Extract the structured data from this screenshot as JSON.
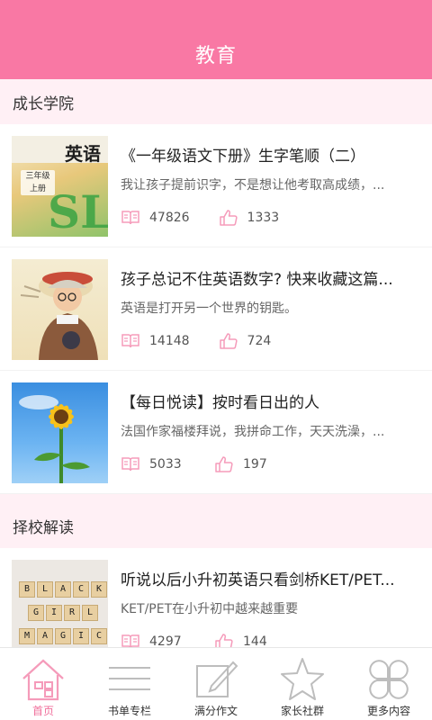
{
  "header": {
    "title": "教育"
  },
  "sections": [
    {
      "title": "成长学院",
      "items": [
        {
          "title": "《一年级语文下册》生字笔顺（二）",
          "subtitle": "我让孩子提前识字，不是想让他考取高成绩，...",
          "reads": "47826",
          "likes": "1333",
          "thumb_text": {
            "zh": "英语",
            "grade": "三年级 上册",
            "letters": "SL"
          }
        },
        {
          "title": "孩子总记不住英语数字? 快来收藏这篇...",
          "subtitle": "英语是打开另一个世界的钥匙。",
          "reads": "14148",
          "likes": "724"
        },
        {
          "title": "【每日悦读】按时看日出的人",
          "subtitle": "法国作家福楼拜说，我拼命工作，天天洗澡，...",
          "reads": "5033",
          "likes": "197"
        }
      ]
    },
    {
      "title": "择校解读",
      "items": [
        {
          "title": "听说以后小升初英语只看剑桥KET/PET...",
          "subtitle": "KET/PET在小升初中越来越重要",
          "reads": "4297",
          "likes": "144",
          "thumb_text": {
            "row1": [
              "B",
              "L",
              "A",
              "C",
              "K"
            ],
            "row2": [
              "G",
              "I",
              "R",
              "L"
            ],
            "row3": [
              "M",
              "A",
              "G",
              "I",
              "C"
            ]
          }
        }
      ]
    }
  ],
  "tabs": [
    {
      "label": "首页",
      "icon": "home-icon",
      "active": true
    },
    {
      "label": "书单专栏",
      "icon": "list-icon",
      "active": false
    },
    {
      "label": "满分作文",
      "icon": "edit-icon",
      "active": false
    },
    {
      "label": "家长社群",
      "icon": "star-icon",
      "active": false
    },
    {
      "label": "更多内容",
      "icon": "clover-icon",
      "active": false
    }
  ],
  "colors": {
    "accent": "#f978a4",
    "section_bg": "#fff0f5",
    "active_tab": "#f06f9b",
    "icon_pink": "#f59bba",
    "icon_gray": "#bdbdbd"
  }
}
